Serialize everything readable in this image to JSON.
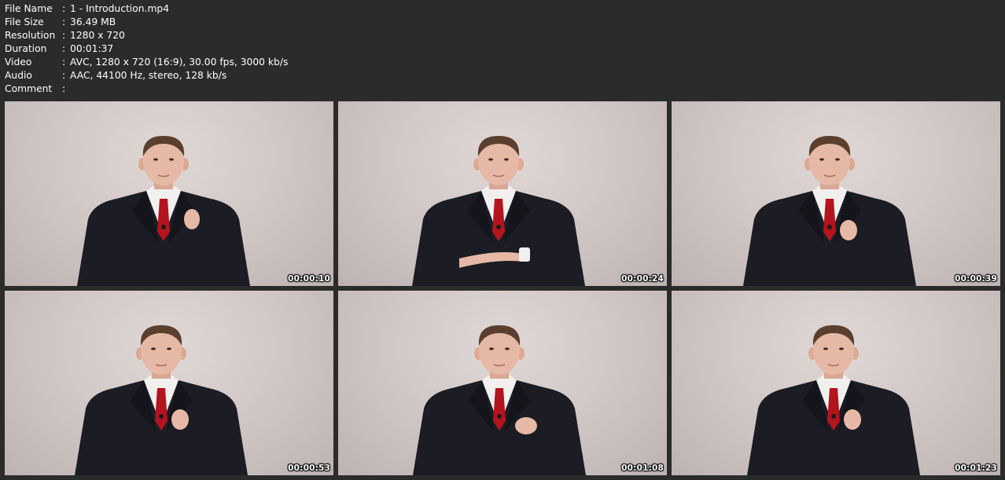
{
  "info": {
    "separator": ":",
    "rows": [
      {
        "key": "File Name",
        "value": "1 - Introduction.mp4"
      },
      {
        "key": "File Size",
        "value": "36.49 MB"
      },
      {
        "key": "Resolution",
        "value": "1280 x 720"
      },
      {
        "key": "Duration",
        "value": "00:01:37"
      },
      {
        "key": "Video",
        "value": "AVC, 1280 x 720 (16:9), 30.00 fps, 3000 kb/s"
      },
      {
        "key": "Audio",
        "value": "AAC, 44100 Hz, stereo, 128 kb/s"
      },
      {
        "key": "Comment",
        "value": ""
      }
    ]
  },
  "thumbnails": [
    {
      "timestamp": "00:00:10"
    },
    {
      "timestamp": "00:00:24"
    },
    {
      "timestamp": "00:00:39"
    },
    {
      "timestamp": "00:00:53"
    },
    {
      "timestamp": "00:01:08"
    },
    {
      "timestamp": "00:01:23"
    }
  ],
  "colors": {
    "background": "#2b2b2b",
    "text": "#ffffff",
    "wall": "#d6cdcb",
    "suit": "#1b1c24",
    "shirt": "#f2f0ef",
    "tie": "#b3141e",
    "skin": "#e6b9a6"
  }
}
